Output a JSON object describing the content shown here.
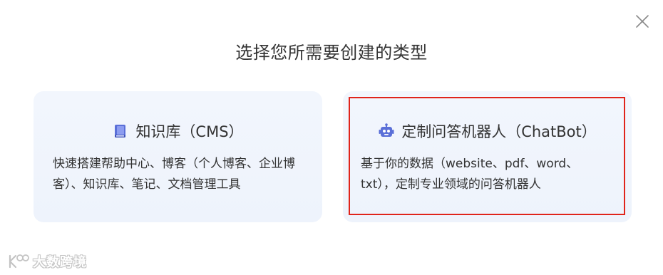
{
  "dialog": {
    "title": "选择您所需要创建的类型",
    "close_icon": "close-icon"
  },
  "cards": {
    "knowledge_base": {
      "icon": "book-icon",
      "title": "知识库（CMS）",
      "description": "快速搭建帮助中心、博客（个人博客、企业博客）、知识库、笔记、文档管理工具"
    },
    "chatbot": {
      "icon": "robot-icon",
      "title": "定制问答机器人（ChatBot）",
      "description": "基于你的数据（website、pdf、word、txt），定制专业领域的问答机器人",
      "highlighted": true,
      "highlight_color": "#e0241b"
    }
  },
  "watermark": {
    "text": "大数跨境"
  },
  "colors": {
    "card_bg": "#f2f6fd",
    "icon_blue": "#5a6fd8",
    "text": "#333333"
  }
}
